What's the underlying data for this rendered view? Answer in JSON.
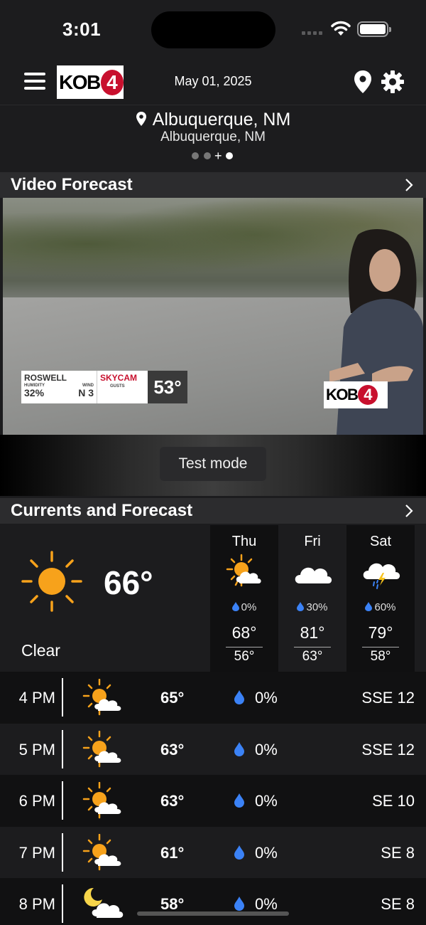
{
  "status_bar": {
    "time": "3:01"
  },
  "app_bar": {
    "logo_text": "KOB",
    "logo_number": "4",
    "date": "May 01, 2025"
  },
  "location": {
    "primary": "Albuquerque, NM",
    "secondary": "Albuquerque, NM",
    "pages": 3,
    "active_page": 3
  },
  "video_section": {
    "title": "Video Forecast",
    "overlay": {
      "city": "ROSWELL",
      "humidity_label": "HUMIDITY",
      "humidity_value": "32%",
      "wind_label": "WIND",
      "wind_value": "N 3",
      "skycam_label": "SKYCAM",
      "gusts_label": "GUSTS",
      "temperature": "53°"
    },
    "logo_text": "KOB",
    "logo_number": "4",
    "test_button": "Test mode"
  },
  "forecast_section": {
    "title": "Currents and Forecast",
    "current": {
      "temp": "66°",
      "condition": "Clear",
      "icon": "sun-icon"
    },
    "days": [
      {
        "name": "Thu",
        "icon": "partly-cloudy-icon",
        "precip": "0%",
        "high": "68°",
        "low": "56°"
      },
      {
        "name": "Fri",
        "icon": "cloud-icon",
        "precip": "30%",
        "high": "81°",
        "low": "63°"
      },
      {
        "name": "Sat",
        "icon": "thunderstorm-icon",
        "precip": "60%",
        "high": "79°",
        "low": "58°"
      }
    ],
    "hourly": [
      {
        "time": "4 PM",
        "icon": "partly-cloudy-icon",
        "temp": "65°",
        "precip": "0%",
        "wind": "SSE 12"
      },
      {
        "time": "5 PM",
        "icon": "partly-cloudy-icon",
        "temp": "63°",
        "precip": "0%",
        "wind": "SSE 12"
      },
      {
        "time": "6 PM",
        "icon": "partly-cloudy-icon",
        "temp": "63°",
        "precip": "0%",
        "wind": "SE 10"
      },
      {
        "time": "7 PM",
        "icon": "partly-cloudy-icon",
        "temp": "61°",
        "precip": "0%",
        "wind": "SE 8"
      },
      {
        "time": "8 PM",
        "icon": "partly-cloudy-night-icon",
        "temp": "58°",
        "precip": "0%",
        "wind": "SE 8"
      }
    ]
  },
  "colors": {
    "accent_red": "#c8102e",
    "sun_orange": "#f7a21b",
    "drop_blue": "#3b82f6",
    "background": "#1c1c1e"
  }
}
